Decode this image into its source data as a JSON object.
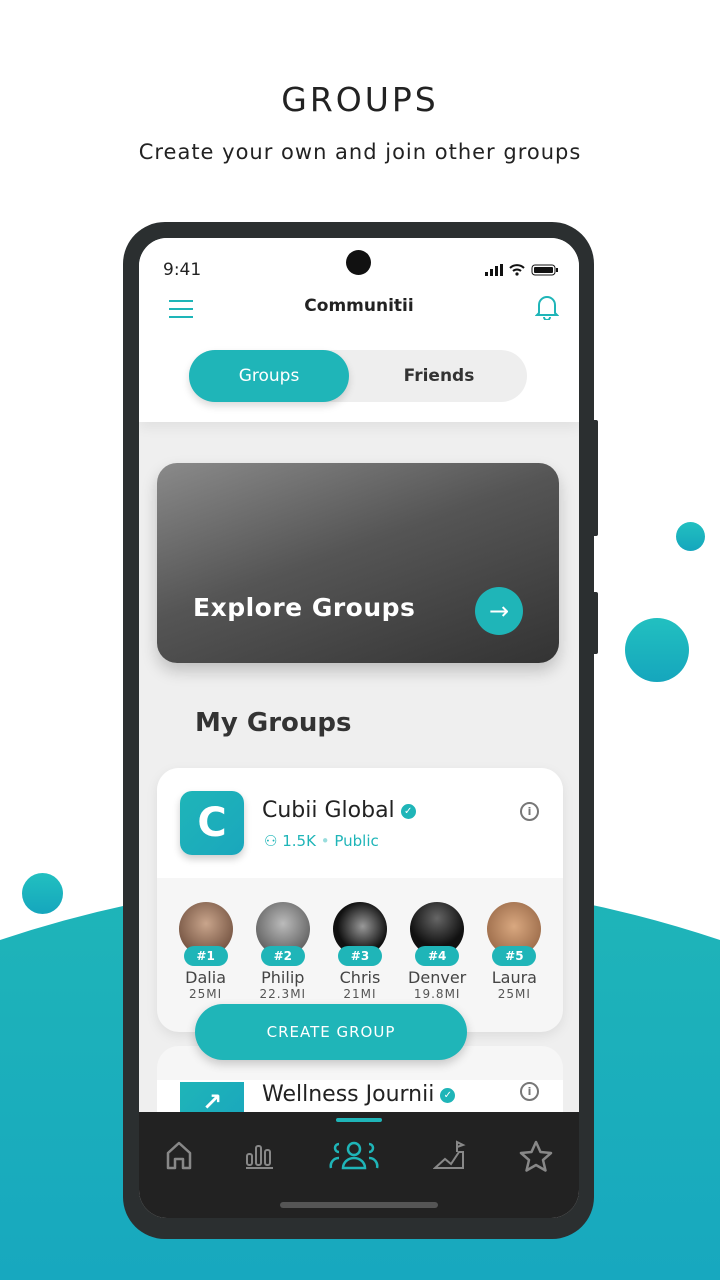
{
  "promo": {
    "headline": "GROUPS",
    "subtitle": "Create your own and join other groups"
  },
  "status_bar": {
    "time": "9:41"
  },
  "header": {
    "title": "Communitii"
  },
  "tabs": [
    {
      "label": "Groups",
      "active": true
    },
    {
      "label": "Friends",
      "active": false
    }
  ],
  "explore": {
    "label": "Explore Groups"
  },
  "my_groups": {
    "title": "My Groups"
  },
  "groups": [
    {
      "name": "Cubii Global",
      "verified": true,
      "members": "1.5K",
      "visibility": "Public",
      "leaders": [
        {
          "rank": "#1",
          "name": "Dalia",
          "distance": "25MI"
        },
        {
          "rank": "#2",
          "name": "Philip",
          "distance": "22.3MI"
        },
        {
          "rank": "#3",
          "name": "Chris",
          "distance": "21MI"
        },
        {
          "rank": "#4",
          "name": "Denver",
          "distance": "19.8MI"
        },
        {
          "rank": "#5",
          "name": "Laura",
          "distance": "25MI"
        }
      ]
    },
    {
      "name": "Wellness Journii",
      "verified": true
    }
  ],
  "create_button": "CREATE GROUP",
  "bottom_nav": [
    {
      "icon": "home-icon"
    },
    {
      "icon": "bar-chart-icon"
    },
    {
      "icon": "groups-icon",
      "active": true
    },
    {
      "icon": "progress-flag-icon"
    },
    {
      "icon": "star-icon"
    }
  ],
  "colors": {
    "accent": "#1fb5b8",
    "nav_bg": "#222222"
  }
}
